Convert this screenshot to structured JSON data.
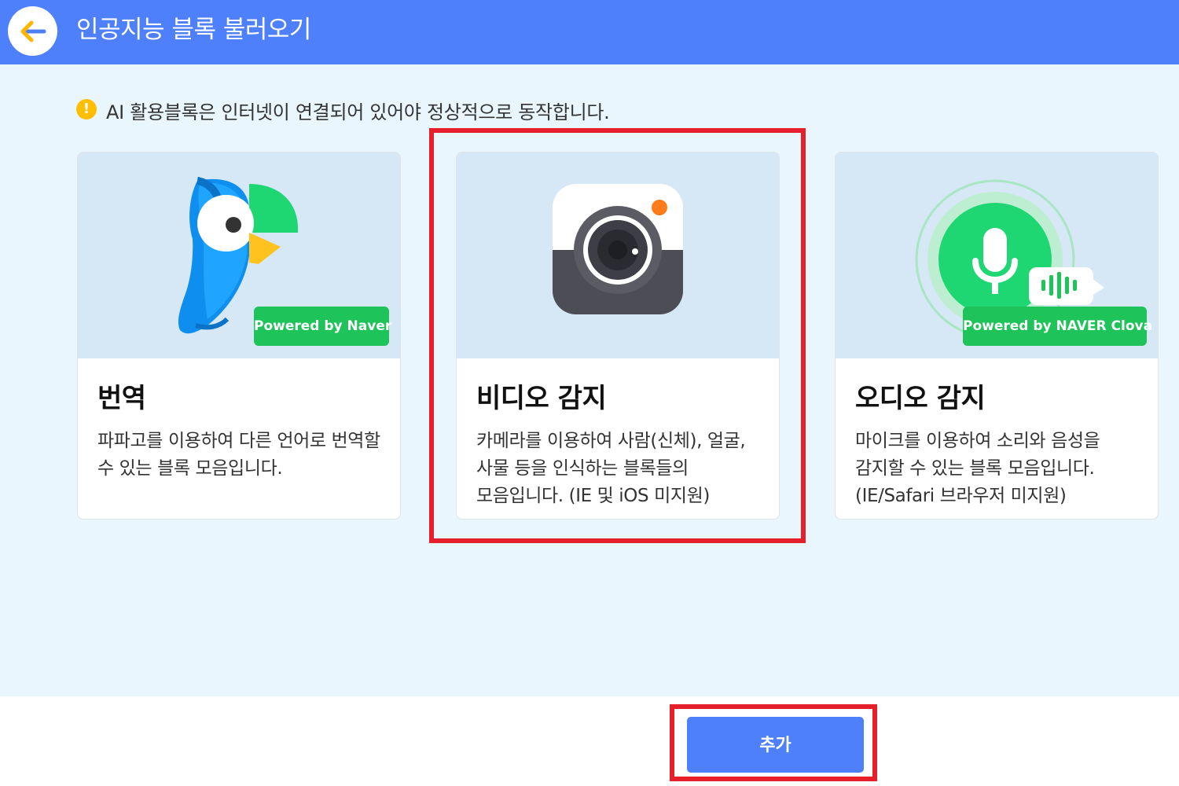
{
  "header": {
    "back_icon": "arrow-left-icon",
    "title": "인공지능 블록 불러오기"
  },
  "notice": {
    "icon": "warning-icon",
    "text": "AI 활용블록은 인터넷이 연결되어 있어야 정상적으로 동작합니다."
  },
  "cards": [
    {
      "title": "번역",
      "description": "파파고를 이용하여 다른 언어로 번역할 수 있는 블록 모음입니다.",
      "badge": "Powered by Naver",
      "icon": "papago-parrot-icon"
    },
    {
      "title": "비디오 감지",
      "description": "카메라를 이용하여 사람(신체), 얼굴, 사물 등을 인식하는 블록들의 모음입니다. (IE 및 iOS 미지원)",
      "icon": "camera-icon",
      "selected": true
    },
    {
      "title": "오디오 감지",
      "description": "마이크를 이용하여 소리와 음성을 감지할 수 있는 블록 모음입니다. (IE/Safari 브라우저 미지원)",
      "badge": "Powered by NAVER Clova",
      "icon": "microphone-icon"
    }
  ],
  "footer": {
    "add_label": "추가"
  },
  "colors": {
    "header": "#4f80fb",
    "background": "#e9f6fd",
    "badge": "#1ec35a",
    "highlight": "#e5202a",
    "button": "#4f80fb"
  }
}
